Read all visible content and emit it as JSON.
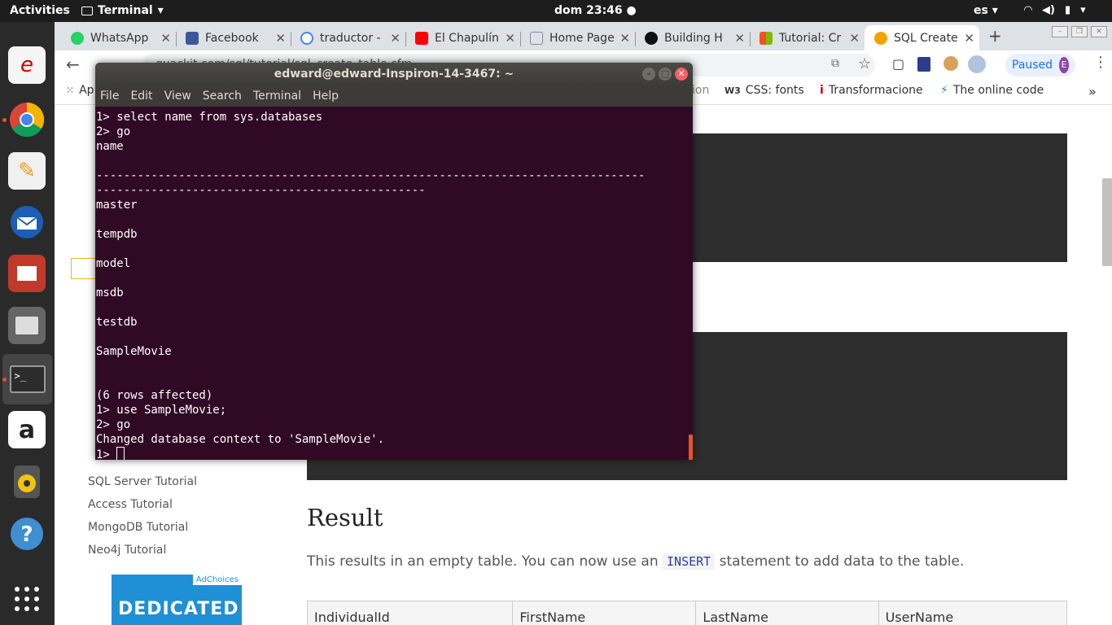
{
  "topbar": {
    "activities": "Activities",
    "app_name": "Terminal",
    "clock": "dom 23:46 ●",
    "lang": "es ▾"
  },
  "tabs": [
    {
      "title": "WhatsApp",
      "icon": "whatsapp-icon",
      "color": "#25d366"
    },
    {
      "title": "Facebook",
      "icon": "facebook-icon",
      "color": "#3b5998"
    },
    {
      "title": "traductor -",
      "icon": "google-icon",
      "color": "#4285f4"
    },
    {
      "title": "El Chapulín",
      "icon": "youtube-icon",
      "color": "#ff0000"
    },
    {
      "title": "Home Page",
      "icon": "page-icon",
      "color": "#8899aa"
    },
    {
      "title": "Building H",
      "icon": "g-icon",
      "color": "#111111"
    },
    {
      "title": "Tutorial: Cr",
      "icon": "microsoft-icon",
      "color": "#f25022"
    },
    {
      "title": "SQL Create",
      "icon": "search-icon",
      "color": "#f4a100"
    }
  ],
  "toolbar": {
    "url": "quackit.com/sql/tutorial/sql_create_table.cfm",
    "paused": "Paused",
    "avatar": "E"
  },
  "bookmarks": {
    "apps": "Ap",
    "b1": "ion",
    "b2": "CSS: fonts",
    "b3": "Transformacione",
    "b4": "The online code"
  },
  "terminal": {
    "title": "edward@edward-Inspiron-14-3467: ~",
    "menu": [
      "File",
      "Edit",
      "View",
      "Search",
      "Terminal",
      "Help"
    ],
    "lines": [
      "1> select name from sys.databases",
      "2> go",
      "name",
      "",
      "--------------------------------------------------------------------------------",
      "------------------------------------------------",
      "master",
      "",
      "tempdb",
      "",
      "model",
      "",
      "msdb",
      "",
      "testdb",
      "",
      "SampleMovie",
      "",
      "",
      "(6 rows affected)",
      "1> use SampleMovie;",
      "2> go",
      "Changed database context to 'SampleMovie'."
    ],
    "prompt": "1> "
  },
  "page": {
    "sidebar_links": [
      "SQL Server Tutorial",
      "Access Tutorial",
      "MongoDB Tutorial",
      "Neo4j Tutorial"
    ],
    "result_title": "Result",
    "result_text_before": "This results in an empty table. You can now use an",
    "result_code": "INSERT",
    "result_text_after": "statement to add data to the table.",
    "table_headers": [
      "IndividualId",
      "FirstName",
      "LastName",
      "UserName"
    ],
    "ad_choices": "AdChoices",
    "ad_text": "DEDICATED"
  }
}
